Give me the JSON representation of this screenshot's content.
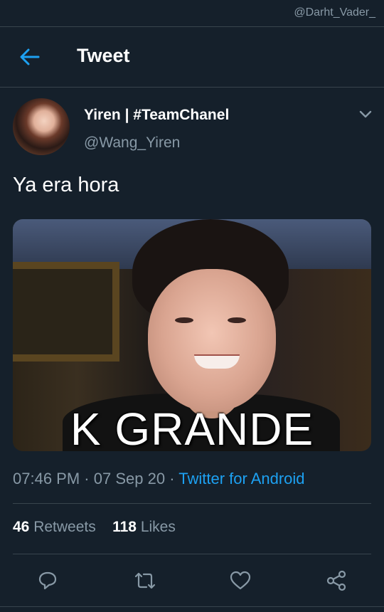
{
  "watermark": "@Darht_Vader_",
  "header": {
    "title": "Tweet"
  },
  "tweet": {
    "display_name": "Yiren | #TeamChanel",
    "handle": "@Wang_Yiren",
    "text": "Ya era hora",
    "media": {
      "caption": "K GRANDE"
    },
    "time": "07:46 PM",
    "date": "07 Sep 20",
    "separator": "·",
    "source": "Twitter for Android",
    "retweets": {
      "count": "46",
      "label": "Retweets"
    },
    "likes": {
      "count": "118",
      "label": "Likes"
    }
  },
  "icons": {
    "back": "arrow-left-icon",
    "more": "chevron-down-icon",
    "reply": "reply-icon",
    "retweet": "retweet-icon",
    "like": "heart-icon",
    "share": "share-icon"
  },
  "colors": {
    "background": "#15202b",
    "accent": "#1da1f2",
    "secondary_text": "#8899a6",
    "divider": "#38444d"
  }
}
